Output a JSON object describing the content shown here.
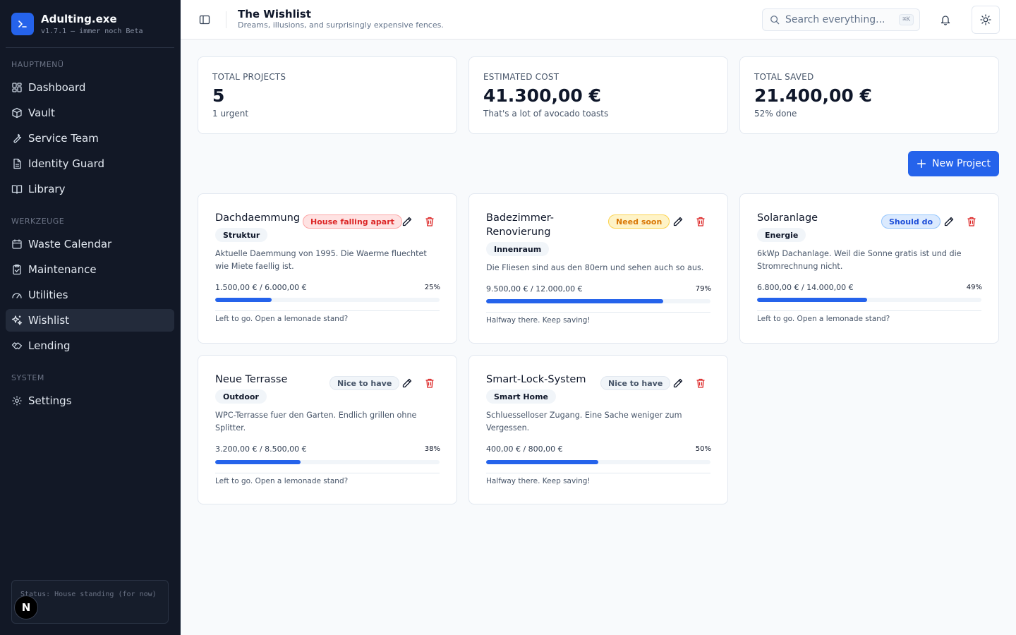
{
  "app": {
    "name": "Adulting.exe",
    "version": "v1.7.1 — immer noch Beta"
  },
  "sidebar": {
    "sections": [
      {
        "heading": "HAUPTMENÜ",
        "items": [
          {
            "label": "Dashboard",
            "icon": "dashboard-icon"
          },
          {
            "label": "Vault",
            "icon": "vault-icon"
          },
          {
            "label": "Service Team",
            "icon": "wrench-icon"
          },
          {
            "label": "Identity Guard",
            "icon": "document-icon"
          },
          {
            "label": "Library",
            "icon": "book-icon"
          }
        ]
      },
      {
        "heading": "WERKZEUGE",
        "items": [
          {
            "label": "Waste Calendar",
            "icon": "calendar-icon"
          },
          {
            "label": "Maintenance",
            "icon": "clipboard-icon"
          },
          {
            "label": "Utilities",
            "icon": "gauge-icon"
          },
          {
            "label": "Wishlist",
            "icon": "sparkles-icon",
            "active": true
          },
          {
            "label": "Lending",
            "icon": "handshake-icon"
          }
        ]
      },
      {
        "heading": "SYSTEM",
        "items": [
          {
            "label": "Settings",
            "icon": "gear-icon"
          }
        ]
      }
    ],
    "status": "Status: House standing (for now)",
    "badge": "N"
  },
  "header": {
    "title": "The Wishlist",
    "subtitle": "Dreams, illusions, and surprisingly expensive fences.",
    "search_placeholder": "Search everything...",
    "search_shortcut": "⌘K"
  },
  "stats": [
    {
      "label": "TOTAL PROJECTS",
      "value": "5",
      "sub": "1 urgent"
    },
    {
      "label": "ESTIMATED COST",
      "value": "41.300,00 €",
      "sub": "That's a lot of avocado toasts"
    },
    {
      "label": "TOTAL SAVED",
      "value": "21.400,00 €",
      "sub": "52% done"
    }
  ],
  "new_project_label": "New Project",
  "colors": {
    "accent": "#2563eb",
    "sidebar_bg": "#121826",
    "danger": "#dc2626"
  },
  "projects": [
    {
      "title": "Dachdaemmung",
      "priority": "House falling apart",
      "priority_style": "red",
      "tag": "Struktur",
      "description": "Aktuelle Daemmung von 1995. Die Waerme fluechtet wie Miete faellig ist.",
      "amount": "1.500,00 € / 6.000,00 €",
      "percent_label": "25%",
      "progress": 0.25,
      "note": "Left to go. Open a lemonade stand?"
    },
    {
      "title": "Badezimmer-Renovierung",
      "priority": "Need soon",
      "priority_style": "orange",
      "tag": "Innenraum",
      "description": "Die Fliesen sind aus den 80ern und sehen auch so aus.",
      "amount": "9.500,00 € / 12.000,00 €",
      "percent_label": "79%",
      "progress": 0.79,
      "note": "Halfway there. Keep saving!"
    },
    {
      "title": "Solaranlage",
      "priority": "Should do",
      "priority_style": "blue",
      "tag": "Energie",
      "description": "6kWp Dachanlage. Weil die Sonne gratis ist und die Stromrechnung nicht.",
      "amount": "6.800,00 € / 14.000,00 €",
      "percent_label": "49%",
      "progress": 0.49,
      "note": "Left to go. Open a lemonade stand?"
    },
    {
      "title": "Neue Terrasse",
      "priority": "Nice to have",
      "priority_style": "gray",
      "tag": "Outdoor",
      "description": "WPC-Terrasse fuer den Garten. Endlich grillen ohne Splitter.",
      "amount": "3.200,00 € / 8.500,00 €",
      "percent_label": "38%",
      "progress": 0.38,
      "note": "Left to go. Open a lemonade stand?"
    },
    {
      "title": "Smart-Lock-System",
      "priority": "Nice to have",
      "priority_style": "gray",
      "tag": "Smart Home",
      "description": "Schluesselloser Zugang. Eine Sache weniger zum Vergessen.",
      "amount": "400,00 € / 800,00 €",
      "percent_label": "50%",
      "progress": 0.5,
      "note": "Halfway there. Keep saving!"
    }
  ]
}
